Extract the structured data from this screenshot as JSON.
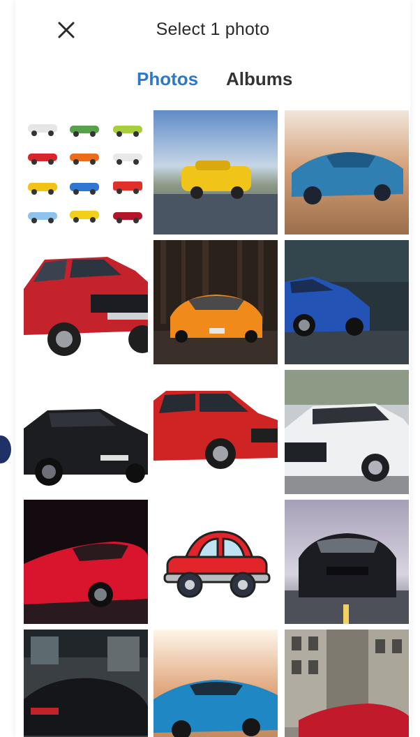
{
  "header": {
    "title": "Select 1 photo",
    "close_icon": "close-icon"
  },
  "tabs": [
    {
      "label": "Photos",
      "active": true
    },
    {
      "label": "Albums",
      "active": false
    }
  ],
  "colors": {
    "accent": "#2e78c8",
    "text": "#2a2a2a"
  },
  "photos": [
    "car-icons-collage",
    "yellow-sports-car-blurred",
    "blue-sports-car-blurred",
    "red-suv",
    "orange-supercar-forest",
    "blue-suv-dark",
    "black-suv",
    "red-compact-suv",
    "white-coupe",
    "red-sports-car",
    "cartoon-red-car",
    "black-muscle-car",
    "black-supercar-rear",
    "blue-camaro",
    "red-car-street"
  ]
}
